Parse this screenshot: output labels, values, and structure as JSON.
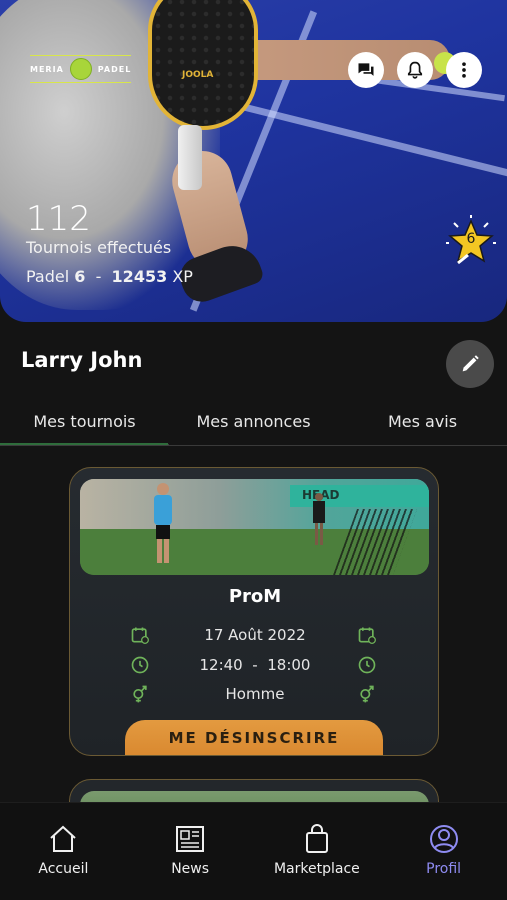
{
  "hero": {
    "logo_left": "MERIA",
    "logo_right": "PADEL",
    "racket_brand": "JOOLA",
    "tournament_count": "112",
    "tournament_label": "Tournois effectués",
    "padel_label": "Padel",
    "padel_level": "6",
    "separator": "-",
    "xp_value": "12453",
    "xp_label": "XP",
    "badge_level": "6"
  },
  "profile": {
    "name": "Larry John"
  },
  "tabs": [
    {
      "label": "Mes tournois",
      "active": true
    },
    {
      "label": "Mes annonces",
      "active": false
    },
    {
      "label": "Mes avis",
      "active": false
    }
  ],
  "tournament": {
    "title": "ProM",
    "date": "17 Août 2022",
    "time_start": "12:40",
    "time_sep": "-",
    "time_end": "18:00",
    "gender": "Homme",
    "action_label": "ME DÉSINSCRIRE",
    "court_sign": "HEAD"
  },
  "bottom_nav": [
    {
      "label": "Accueil",
      "icon": "home-icon",
      "active": false
    },
    {
      "label": "News",
      "icon": "newspaper-icon",
      "active": false
    },
    {
      "label": "Marketplace",
      "icon": "shopping-bag-icon",
      "active": false
    },
    {
      "label": "Profil",
      "icon": "profile-icon",
      "active": true
    }
  ],
  "colors": {
    "accent_orange": "#e39a40",
    "active_nav": "#8f8cf2",
    "card_border": "#6b5a34",
    "icon_green": "#6fb35a",
    "background": "#141414"
  }
}
